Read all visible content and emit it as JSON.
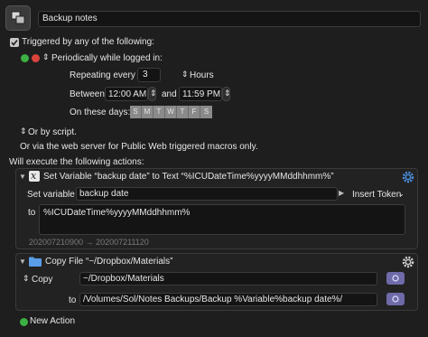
{
  "macro": {
    "name": "Backup notes"
  },
  "trigger": {
    "heading": "Triggered by any of the following:",
    "periodic_label": "Periodically while logged in:",
    "repeating_label": "Repeating every",
    "repeat_value": "3",
    "unit_value": "Hours",
    "between_label": "Between",
    "start_time": "12:00 AM",
    "and_label": "and",
    "end_time": "11:59 PM",
    "days_label": "On these days:",
    "days": [
      "S",
      "M",
      "T",
      "W",
      "T",
      "F",
      "S"
    ],
    "or_by_script": "Or by script.",
    "web_server_text": "Or via the web server for Public Web triggered macros only."
  },
  "actions_heading": "Will execute the following actions:",
  "action1": {
    "title": "Set Variable “backup date” to Text “%ICUDateTime%yyyyMMddhhmm%”",
    "set_variable_label": "Set variable",
    "variable_name": "backup date",
    "insert_token_label": "Insert Token",
    "to_label": "to",
    "to_value": "%ICUDateTime%yyyyMMddhhmm%",
    "preview": "202007210900 → 202007211120"
  },
  "action2": {
    "title": "Copy File “~/Dropbox/Materials”",
    "mode_label": "Copy",
    "source_value": "~/Dropbox/Materials",
    "to_label": "to",
    "destination_value": "/Volumes/Sol/Notes Backups/Backup %Variable%backup date%/"
  },
  "new_action_label": "New Action",
  "colors": {
    "background": "#1e1e1e",
    "add_green": "#3cb043",
    "remove_red": "#d9433b",
    "gear_blue": "#4a8fe0",
    "folder_blue": "#5a9de8",
    "camera_purple": "#6f6aa8"
  },
  "icons": [
    "macro-icon",
    "checkbox-icon",
    "add-icon",
    "remove-icon",
    "stepper-icon",
    "chevron-down-icon",
    "disclosure-arrow-icon",
    "variable-x-icon",
    "folder-icon",
    "gear-icon",
    "camera-icon"
  ]
}
